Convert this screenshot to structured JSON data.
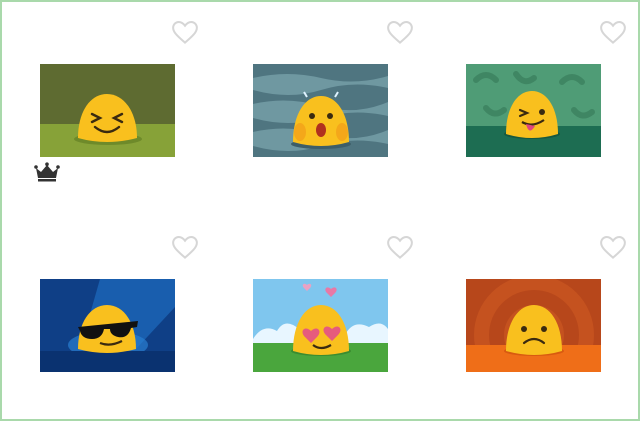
{
  "colors": {
    "frame_border": "#a9d9ab",
    "heart_outline": "#d6d6d6",
    "emoji_yellow": "#f9c01e",
    "crown": "#333333"
  },
  "grid": {
    "items": [
      {
        "id": "grinning-squint",
        "icon": "heart-outline-icon",
        "favorited": false,
        "premium": true,
        "badge_icon": "crown-icon"
      },
      {
        "id": "shocked-face",
        "icon": "heart-outline-icon",
        "favorited": false,
        "premium": false
      },
      {
        "id": "winking-tongue",
        "icon": "heart-outline-icon",
        "favorited": false,
        "premium": false
      },
      {
        "id": "cool-sunglasses",
        "icon": "heart-outline-icon",
        "favorited": false,
        "premium": false
      },
      {
        "id": "heart-eyes",
        "icon": "heart-outline-icon",
        "favorited": false,
        "premium": false
      },
      {
        "id": "sad-face",
        "icon": "heart-outline-icon",
        "favorited": false,
        "premium": false
      }
    ]
  }
}
